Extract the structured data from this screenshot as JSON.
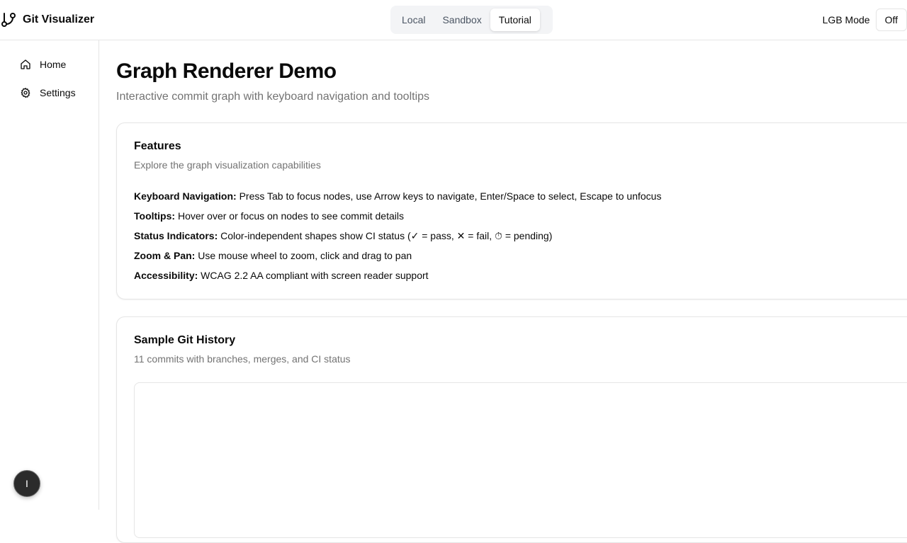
{
  "header": {
    "brand_title": "Git Visualizer",
    "modes": [
      "Local",
      "Sandbox",
      "Tutorial"
    ],
    "active_mode": "Tutorial",
    "lgb_label": "LGB Mode",
    "lgb_value": "Off"
  },
  "sidebar": {
    "items": [
      {
        "label": "Home",
        "icon": "home-icon"
      },
      {
        "label": "Settings",
        "icon": "gear-icon"
      }
    ],
    "fab_label": "I"
  },
  "main": {
    "title": "Graph Renderer Demo",
    "subtitle": "Interactive commit graph with keyboard navigation and tooltips",
    "features_card": {
      "title": "Features",
      "description": "Explore the graph visualization capabilities",
      "items": [
        {
          "label": "Keyboard Navigation:",
          "text": " Press Tab to focus nodes, use Arrow keys to navigate, Enter/Space to select, Escape to unfocus"
        },
        {
          "label": "Tooltips:",
          "text": " Hover over or focus on nodes to see commit details"
        },
        {
          "label": "Status Indicators:",
          "text": " Color-independent shapes show CI status (✓ = pass, ✕ = fail, ⏱ = pending)"
        },
        {
          "label": "Zoom & Pan:",
          "text": " Use mouse wheel to zoom, click and drag to pan"
        },
        {
          "label": "Accessibility:",
          "text": " WCAG 2.2 AA compliant with screen reader support"
        }
      ]
    },
    "history_card": {
      "title": "Sample Git History",
      "description": "11 commits with branches, merges, and CI status"
    }
  },
  "colors": {
    "border": "#e5e5e5",
    "muted_text": "#737373",
    "tab_bg": "#f3f4f6",
    "fab_bg": "#2b2b2b"
  }
}
